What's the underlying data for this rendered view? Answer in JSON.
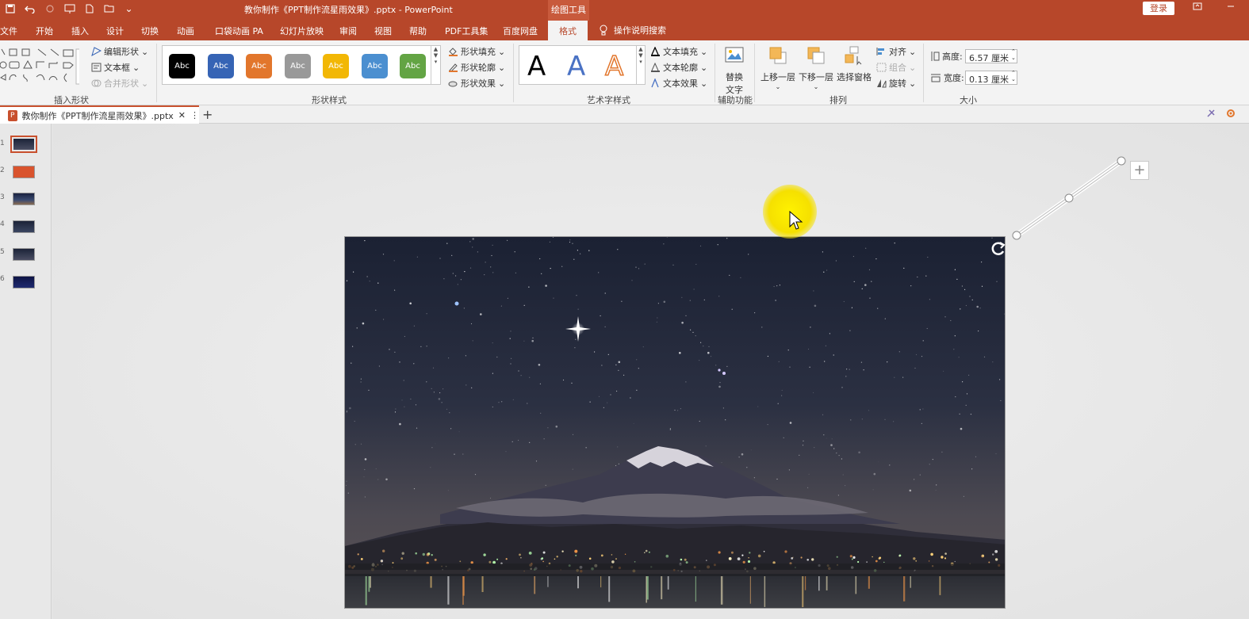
{
  "title_bar": {
    "title": "教你制作《PPT制作流星雨效果》.pptx  -  PowerPoint",
    "context_group": "绘图工具",
    "login": "登录",
    "qat_more": "⌄"
  },
  "tabs": [
    {
      "label": "文件"
    },
    {
      "label": "开始"
    },
    {
      "label": "插入"
    },
    {
      "label": "设计"
    },
    {
      "label": "切换"
    },
    {
      "label": "动画"
    },
    {
      "label": "口袋动画 PA"
    },
    {
      "label": "幻灯片放映"
    },
    {
      "label": "审阅"
    },
    {
      "label": "视图"
    },
    {
      "label": "帮助"
    },
    {
      "label": "PDF工具集"
    },
    {
      "label": "百度网盘"
    },
    {
      "label": "格式"
    }
  ],
  "active_tab": "格式",
  "tell_me": "操作说明搜索",
  "ribbon": {
    "insert_shapes": {
      "label": "插入形状",
      "edit_shape": "编辑形状",
      "text_box": "文本框",
      "merge_shapes": "合并形状"
    },
    "shape_styles": {
      "label": "形状样式",
      "swatch_text": "Abc",
      "swatches": [
        "#000000",
        "#3664b5",
        "#e2762c",
        "#999999",
        "#f2b705",
        "#4b8fd0",
        "#63a444"
      ],
      "fill": "形状填充",
      "outline": "形状轮廓",
      "effects": "形状效果"
    },
    "wordart_styles": {
      "label": "艺术字样式",
      "letter": "A",
      "text_fill": "文本填充",
      "text_outline": "文本轮廓",
      "text_effects": "文本效果"
    },
    "accessibility": {
      "label": "辅助功能",
      "alt_text_line1": "替换",
      "alt_text_line2": "文字"
    },
    "arrange": {
      "label": "排列",
      "bring_forward": "上移一层",
      "send_backward": "下移一层",
      "selection_pane": "选择窗格",
      "align": "对齐",
      "group": "组合",
      "rotate": "旋转"
    },
    "size": {
      "label": "大小",
      "height_label": "高度:",
      "height_value": "6.57 厘米",
      "width_label": "宽度:",
      "width_value": "0.13 厘米"
    }
  },
  "document_tab": {
    "name": "教你制作《PPT制作流星雨效果》.pptx",
    "icon_letter": "P"
  },
  "slides": [
    {
      "num": "1",
      "selected": true
    },
    {
      "num": "2",
      "selected": false
    },
    {
      "num": "3",
      "selected": false
    },
    {
      "num": "4",
      "selected": false
    },
    {
      "num": "5",
      "selected": false
    },
    {
      "num": "6",
      "selected": false
    }
  ],
  "colors": {
    "accent": "#b7472a",
    "tab_active_text": "#b7472a",
    "cursor_highlight": "#fff200"
  }
}
